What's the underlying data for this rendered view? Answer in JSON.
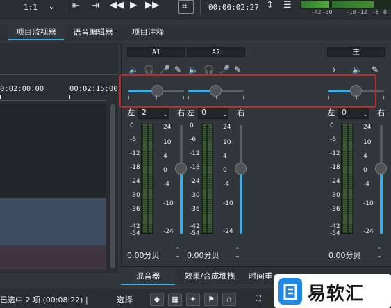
{
  "toolbar": {
    "zoom": "1:1",
    "timecode": "00:00:02:27",
    "meter_labels": [
      "-42",
      "-30",
      "-18",
      "-12",
      "-6",
      "0"
    ]
  },
  "tabs": [
    {
      "label": "项目监视器",
      "active": true
    },
    {
      "label": "语音编辑器",
      "active": false
    },
    {
      "label": "项目注释",
      "active": false
    }
  ],
  "timeline": {
    "ruler": [
      "0:02:00:00",
      "00:02:15:00"
    ]
  },
  "mixer": {
    "channels": [
      {
        "name": "A1",
        "pan_left_label": "左",
        "pan_right_label": "右",
        "pan_value": "2",
        "pan_pos": 0.52,
        "db_value": "0.00分贝",
        "fader_level": 0.6
      },
      {
        "name": "A2",
        "pan_left_label": "左",
        "pan_right_label": "右",
        "pan_value": "0",
        "pan_pos": 0.5,
        "db_value": "0.00分贝",
        "fader_level": 0.6
      },
      {
        "name": "主",
        "pan_left_label": "左",
        "pan_right_label": "右",
        "pan_value": "0",
        "pan_pos": 0.5,
        "db_value": "0.00分贝",
        "fader_level": 0.6
      }
    ],
    "meter_scale": [
      "0",
      "-6",
      "-12",
      "-18",
      "-24",
      "-30",
      "-36",
      "-42",
      "-54"
    ],
    "fader_scale": [
      "24",
      "10",
      "4",
      "0",
      "-4",
      "-10",
      "-24"
    ]
  },
  "mixer_tabs": [
    {
      "label": "混音器",
      "active": true
    },
    {
      "label": "效果/合成堆栈",
      "active": false
    },
    {
      "label": "时间重",
      "active": false
    }
  ],
  "status": {
    "selection": "已选中 2 项 (00:08:22) |",
    "mode": "选择"
  },
  "watermark": "易软汇",
  "colors": {
    "accent": "#3daee9",
    "highlight_box": "#c62828",
    "background": "#31363b"
  }
}
